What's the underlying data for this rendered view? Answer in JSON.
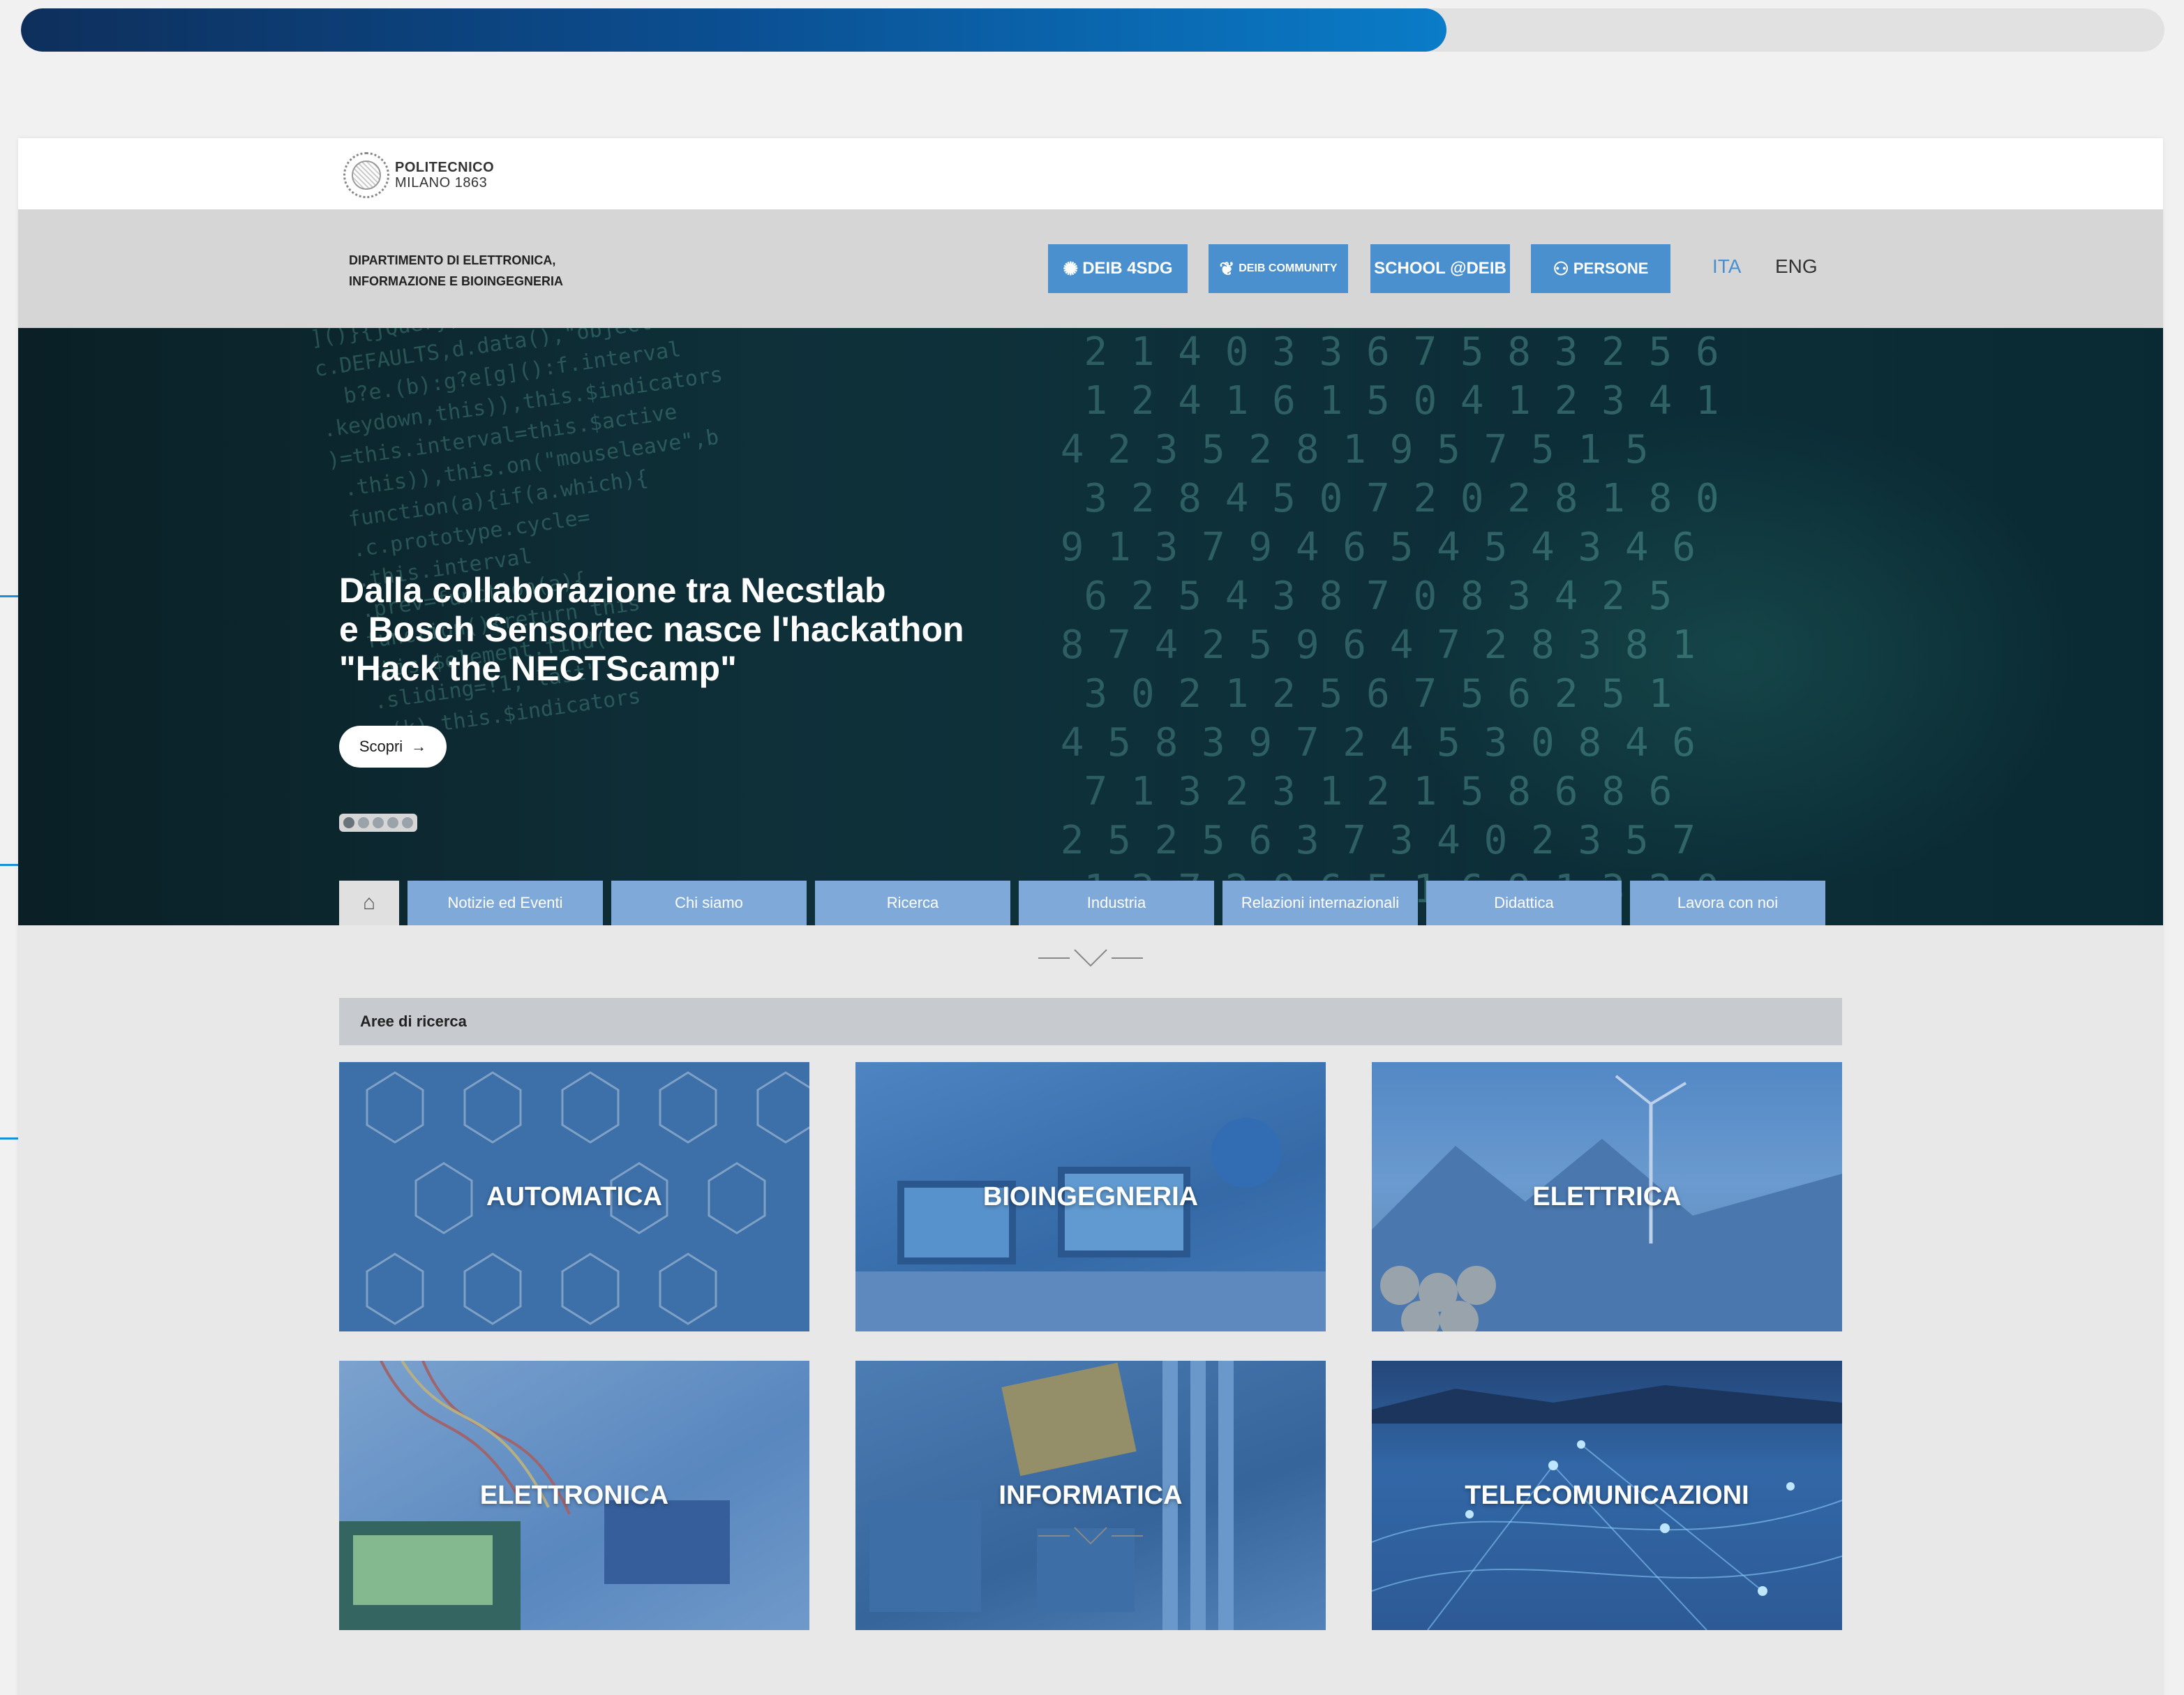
{
  "progress": {
    "fraction": 0.665
  },
  "logo": {
    "line1": "POLITECNICO",
    "line2": "MILANO 1863"
  },
  "department": {
    "name_line1": "DIPARTIMENTO DI ELETTRONICA,",
    "name_line2": "INFORMAZIONE E BIOINGEGNERIA"
  },
  "dept_buttons": [
    {
      "label": "DEIB 4SDG",
      "icon": "sdg-icon"
    },
    {
      "label": "DEIB COMMUNITY",
      "icon": "laurel-icon"
    },
    {
      "label": "SCHOOL @DEIB",
      "icon": ""
    },
    {
      "label": "PERSONE",
      "icon": "people-icon"
    }
  ],
  "languages": {
    "ita": "ITA",
    "eng": "ENG"
  },
  "hero": {
    "title_line1": "Dalla collaborazione tra Necstlab",
    "title_line2": "e Bosch Sensortec nasce l'hackathon",
    "title_line3": "\"Hack the NECTScamp\"",
    "cta_label": "Scopri",
    "cta_icon": "arrow-right-icon",
    "slides_count": 5,
    "active_slide": 1
  },
  "nav": {
    "home_icon": "home-icon",
    "items": [
      "Notizie ed Eventi",
      "Chi siamo",
      "Ricerca",
      "Industria",
      "Relazioni internazionali",
      "Didattica",
      "Lavora con noi"
    ]
  },
  "research": {
    "heading": "Aree di ricerca",
    "areas": [
      "AUTOMATICA",
      "BIOINGEGNERIA",
      "ELETTRICA",
      "ELETTRONICA",
      "INFORMATICA",
      "TELECOMUNICAZIONI"
    ]
  },
  "colors": {
    "accent": "#4a90cf",
    "nav_tab": "#7fa9d8",
    "callout": "#1a8fd8",
    "progress_start": "#0e2f5c",
    "progress_end": "#0a7cc8"
  }
}
